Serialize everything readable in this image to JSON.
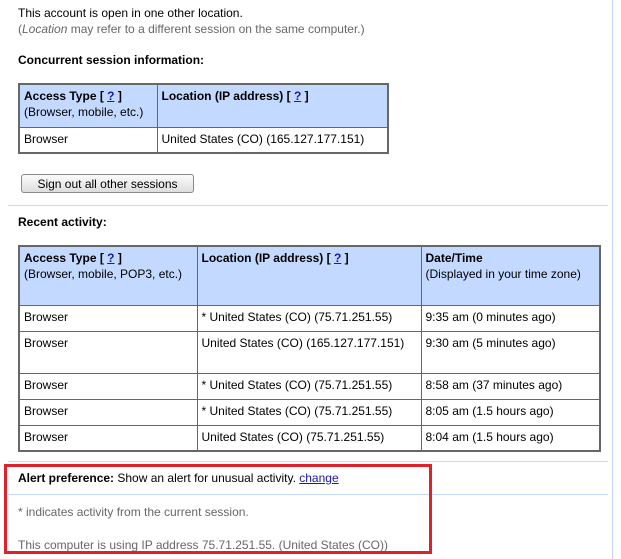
{
  "intro": {
    "line1": "This account is open in one other location.",
    "line2_italic": "Location",
    "line2_rest": " may refer to a different session on the same computer.)",
    "line2_open": "("
  },
  "concurrent": {
    "heading": "Concurrent session information:",
    "headers": [
      {
        "title": "Access Type [ ",
        "help": "?",
        "close": " ]",
        "sub": "(Browser, mobile, etc.)"
      },
      {
        "title": "Location (IP address) [ ",
        "help": "?",
        "close": " ]",
        "sub": ""
      }
    ],
    "rows": [
      [
        "Browser",
        "United States (CO) (165.127.177.151)"
      ]
    ],
    "signout_label": "Sign out all other sessions"
  },
  "recent": {
    "heading": "Recent activity:",
    "headers": [
      {
        "title": "Access Type [ ",
        "help": "?",
        "close": " ]",
        "sub": "(Browser, mobile, POP3, etc.)"
      },
      {
        "title": "Location (IP address) [ ",
        "help": "?",
        "close": " ]",
        "sub": ""
      },
      {
        "title": "Date/Time",
        "help": "",
        "close": "",
        "sub": "(Displayed in your time zone)"
      }
    ],
    "rows": [
      [
        "Browser",
        "* United States (CO) (75.71.251.55)",
        "9:35 am (0 minutes ago)"
      ],
      [
        "Browser",
        "United States (CO) (165.127.177.151)",
        "9:30 am (5 minutes ago)"
      ],
      [
        "Browser",
        "* United States (CO) (75.71.251.55)",
        "8:58 am (37 minutes ago)"
      ],
      [
        "Browser",
        "* United States (CO) (75.71.251.55)",
        "8:05 am (1.5 hours ago)"
      ],
      [
        "Browser",
        "United States (CO) (75.71.251.55)",
        "8:04 am (1.5 hours ago)"
      ]
    ]
  },
  "alert": {
    "label": "Alert preference:",
    "text": " Show an alert for unusual activity. ",
    "change_link": "change"
  },
  "footnote": "* indicates activity from the current session.",
  "ip_note": "This computer is using IP address 75.71.251.55. (United States (CO))",
  "colors": {
    "header_bg": "#c3d9ff",
    "separator": "#c3d9ff",
    "highlight_box": "#e0202a",
    "link": "#1a1aa6"
  }
}
